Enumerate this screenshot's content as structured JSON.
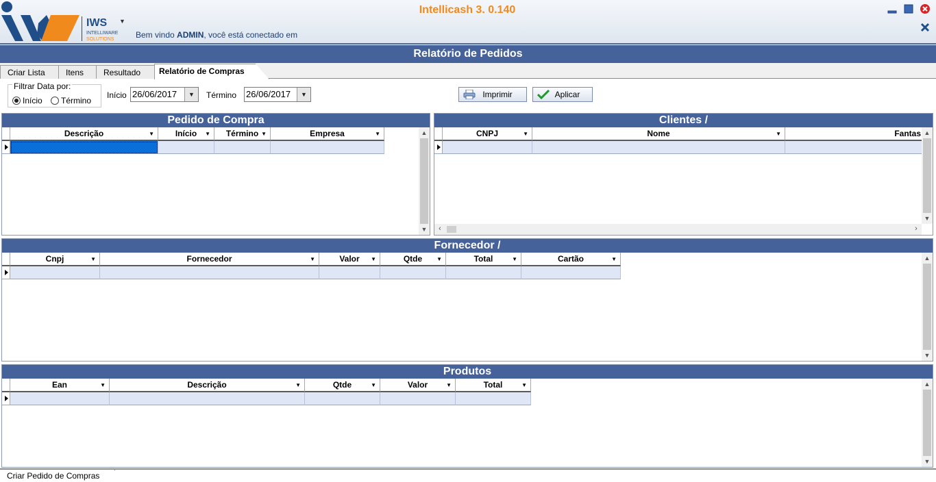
{
  "header": {
    "logo_text": "IWS",
    "logo_sub1": "INTELLIWARE",
    "logo_sub2": "SOLUTIONS",
    "app_title": "Intellicash 3. 0.140",
    "welcome_prefix": "Bem vindo ",
    "welcome_user": "ADMIN",
    "welcome_suffix": ", você está conectado em",
    "brand_orange": "#f08a1c",
    "brand_blue": "#1a3f77"
  },
  "page_title": "Relatório de Pedidos",
  "tabs": [
    {
      "label": "Criar Lista"
    },
    {
      "label": "Itens"
    },
    {
      "label": "Resultado"
    },
    {
      "label": "Relatório de Compras",
      "active": true
    }
  ],
  "filter": {
    "legend": "Filtrar Data por:",
    "option_inicio": "Início",
    "option_termino": "Término",
    "selected": "Início",
    "inicio_label": "Início",
    "inicio_value": "26/06/2017",
    "termino_label": "Término",
    "termino_value": "26/06/2017"
  },
  "buttons": {
    "print": "Imprimir",
    "apply": "Aplicar"
  },
  "panels": {
    "pedido": {
      "title": "Pedido de Compra",
      "columns": [
        "Descrição",
        "Início",
        "Término",
        "Empresa"
      ]
    },
    "clientes": {
      "title": "Clientes /",
      "columns": [
        "CNPJ",
        "Nome",
        "Fantas"
      ]
    },
    "fornecedor": {
      "title": "Fornecedor /",
      "columns": [
        "Cnpj",
        "Fornecedor",
        "Valor",
        "Qtde",
        "Total",
        "Cartão"
      ]
    },
    "produtos": {
      "title": "Produtos",
      "columns": [
        "Ean",
        "Descrição",
        "Qtde",
        "Valor",
        "Total"
      ]
    }
  },
  "bottom_tab": "Criar Pedido de Compras",
  "colors": {
    "header_bar": "#46629a",
    "row_fill": "#dfe7f7",
    "selected_cell": "#0a6fd8"
  }
}
